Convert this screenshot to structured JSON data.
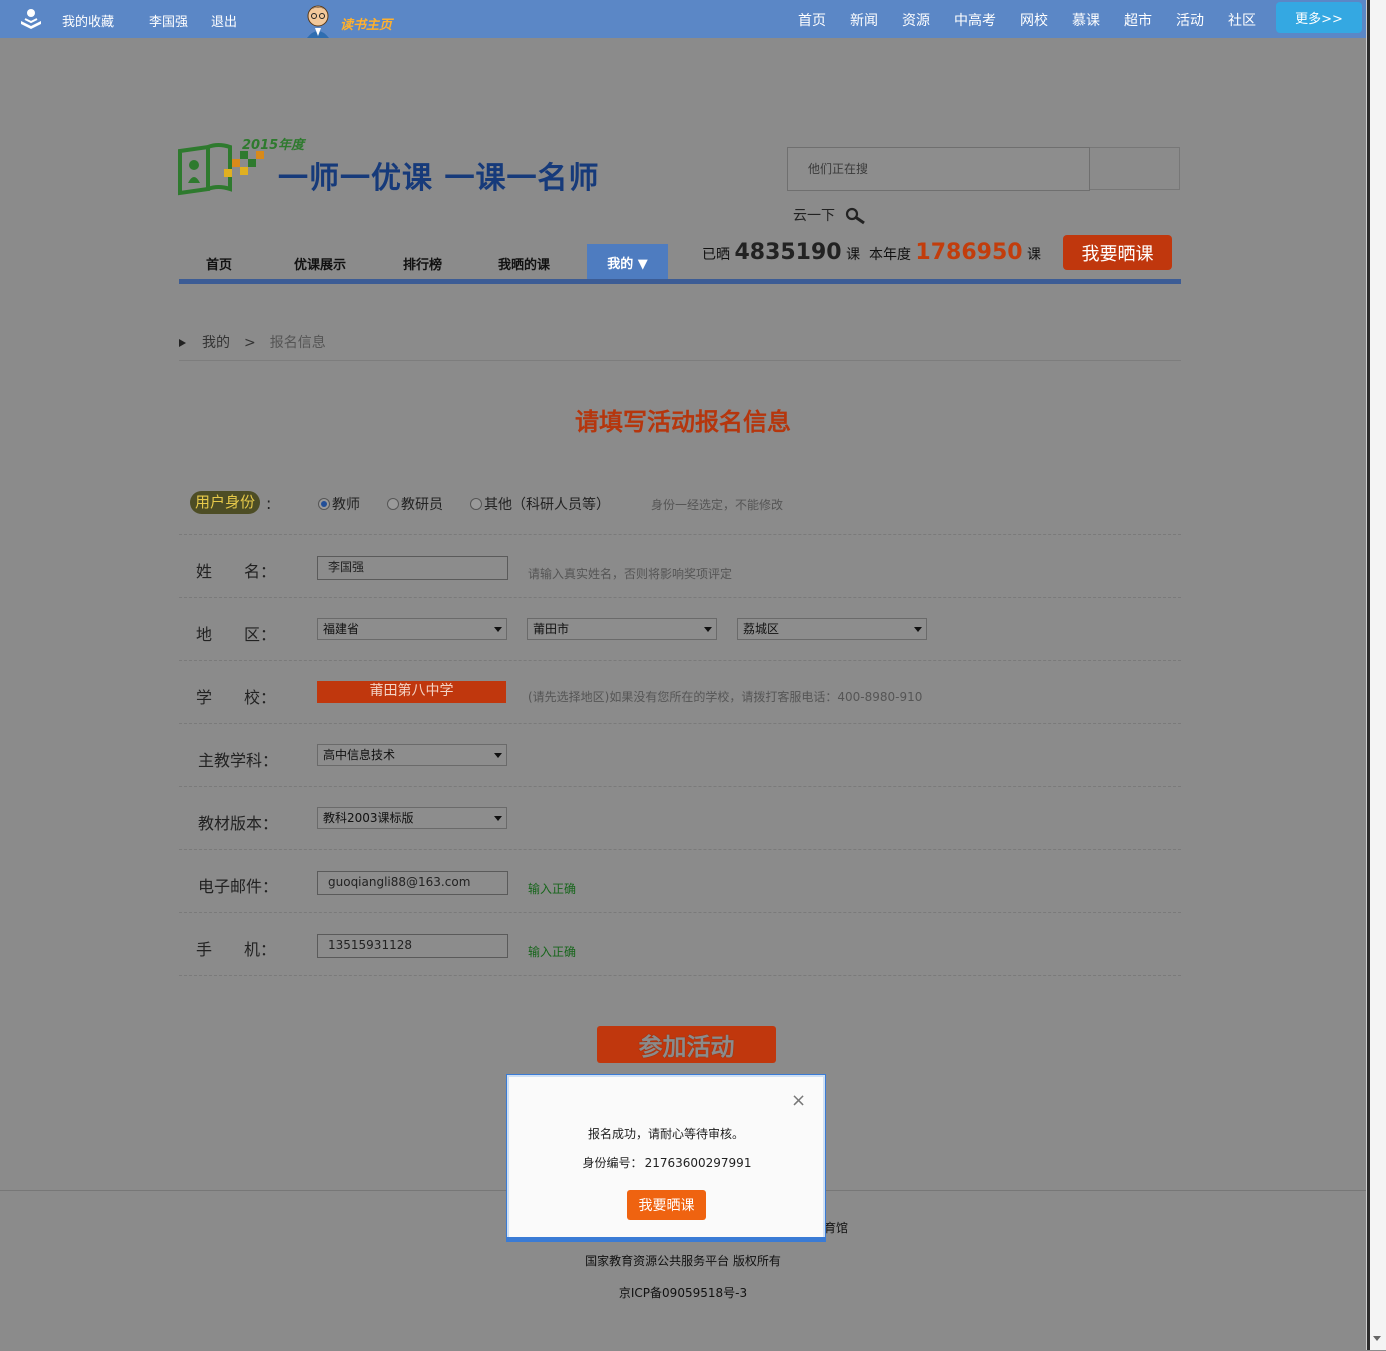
{
  "topbar": {
    "favorites": "我的收藏",
    "username": "李国强",
    "logout": "退出",
    "brand": "读书主页",
    "nav": [
      "首页",
      "新闻",
      "资源",
      "中高考",
      "网校",
      "慕课",
      "超市",
      "活动",
      "社区"
    ],
    "more": "更多>>"
  },
  "header": {
    "year": "2015年度",
    "slogan": "一师一优课  一课一名师",
    "search_placeholder": "他们正在搜",
    "search_button": "云一下"
  },
  "mainnav": {
    "items": [
      "首页",
      "优课展示",
      "排行榜",
      "我晒的课"
    ],
    "active": "我的 ▼"
  },
  "stats": {
    "prefix": "已晒",
    "total": "4835190",
    "unit1": "课",
    "year_label": "本年度",
    "year_total": "1786950",
    "unit2": "课",
    "shaike": "我要晒课"
  },
  "breadcrumb": {
    "root": "我的",
    "sep": ">",
    "current": "报名信息"
  },
  "form": {
    "title": "请填写活动报名信息",
    "role_label": "用户身份",
    "roles": [
      "教师",
      "教研员",
      "其他（科研人员等）"
    ],
    "role_hint": "身份一经选定，不能修改",
    "name_label": "姓　　名：",
    "name_value": "李国强",
    "name_hint": "请输入真实姓名，否则将影响奖项评定",
    "region_label": "地　　区：",
    "province": "福建省",
    "city": "莆田市",
    "district": "荔城区",
    "school_label": "学　　校：",
    "school_value": "莆田第八中学",
    "school_hint": "(请先选择地区)如果没有您所在的学校，请拨打客服电话：400-8980-910",
    "subject_label": "主教学科：",
    "subject_value": "高中信息技术",
    "textbook_label": "教材版本：",
    "textbook_value": "教科2003课标版",
    "email_label": "电子邮件：",
    "email_value": "guoqiangli88@163.com",
    "email_ok": "输入正确",
    "phone_label": "手　　机：",
    "phone_value": "13515931128",
    "phone_ok": "输入正确",
    "submit": "参加活动"
  },
  "modal": {
    "message": "报名成功，请耐心等待审核。",
    "id_label": "身份编号：",
    "id_value": "21763600297991",
    "button": "我要晒课",
    "close": "×"
  },
  "footer": {
    "fragment": "育馆",
    "line2": "国家教育资源公共服务平台   版权所有",
    "line3": "京ICP备09059518号-3"
  }
}
